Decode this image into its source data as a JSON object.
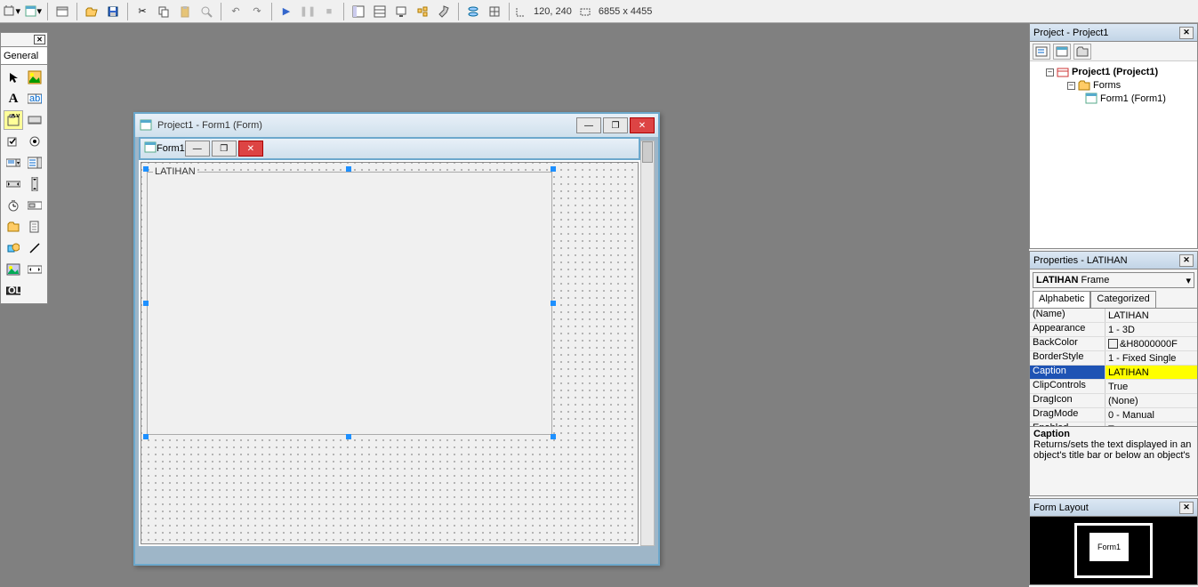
{
  "toolbar": {
    "coords": "120, 240",
    "dimensions": "6855 x 4455"
  },
  "toolbox": {
    "tab": "General"
  },
  "mdi": {
    "title": "Project1 - Form1 (Form)"
  },
  "form": {
    "title": "Form1",
    "frame_caption": "LATIHAN"
  },
  "project_panel": {
    "title": "Project - Project1",
    "root": "Project1 (Project1)",
    "folder": "Forms",
    "item": "Form1 (Form1)"
  },
  "properties_panel": {
    "title": "Properties - LATIHAN",
    "selector_name": "LATIHAN",
    "selector_type": "Frame",
    "tab_alpha": "Alphabetic",
    "tab_cat": "Categorized",
    "rows": [
      {
        "name": "(Name)",
        "val": "LATIHAN"
      },
      {
        "name": "Appearance",
        "val": "1 - 3D"
      },
      {
        "name": "BackColor",
        "val": "&H8000000F",
        "swatch": true
      },
      {
        "name": "BorderStyle",
        "val": "1 - Fixed Single"
      },
      {
        "name": "Caption",
        "val": "LATIHAN",
        "sel": true
      },
      {
        "name": "ClipControls",
        "val": "True"
      },
      {
        "name": "DragIcon",
        "val": "(None)"
      },
      {
        "name": "DragMode",
        "val": "0 - Manual"
      },
      {
        "name": "Enabled",
        "val": "True"
      }
    ],
    "desc_title": "Caption",
    "desc_text": "Returns/sets the text displayed in an object's title bar or below an object's"
  },
  "formlayout_panel": {
    "title": "Form Layout",
    "form_label": "Form1"
  }
}
